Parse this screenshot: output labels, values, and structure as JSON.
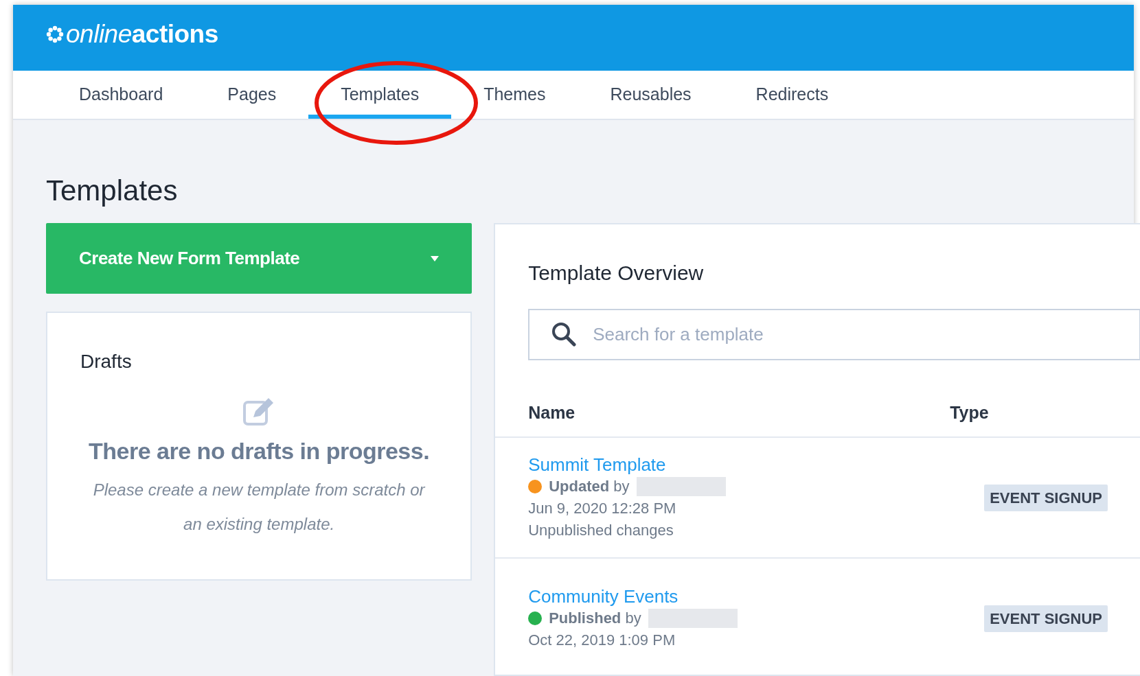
{
  "header": {
    "logo": {
      "light": "online",
      "bold": "actions"
    }
  },
  "nav": {
    "tabs": [
      {
        "label": "Dashboard",
        "selected": false
      },
      {
        "label": "Pages",
        "selected": false
      },
      {
        "label": "Templates",
        "selected": true
      },
      {
        "label": "Themes",
        "selected": false
      },
      {
        "label": "Reusables",
        "selected": false
      },
      {
        "label": "Redirects",
        "selected": false
      }
    ]
  },
  "page_title": "Templates",
  "create_button": {
    "label": "Create New Form Template"
  },
  "drafts": {
    "title": "Drafts",
    "empty_title": "There are no drafts in progress.",
    "empty_text": "Please create a new template from scratch or an existing template."
  },
  "overview": {
    "title": "Template Overview",
    "search": {
      "placeholder": "Search for a template"
    },
    "columns": [
      "Name",
      "Type"
    ],
    "rows": [
      {
        "name": "Summit Template",
        "status": "**Updated** by",
        "color": "#f7931e",
        "date": "Jun 9, 2020 12:28 PM",
        "note": "Unpublished changes",
        "type": "EVENT SIGNUP"
      },
      {
        "name": "Community Events",
        "status": "**Published** by",
        "color": "#27b14f",
        "date": "Oct 22, 2019 1:09 PM",
        "type": "EVENT SIGNUP"
      }
    ]
  }
}
